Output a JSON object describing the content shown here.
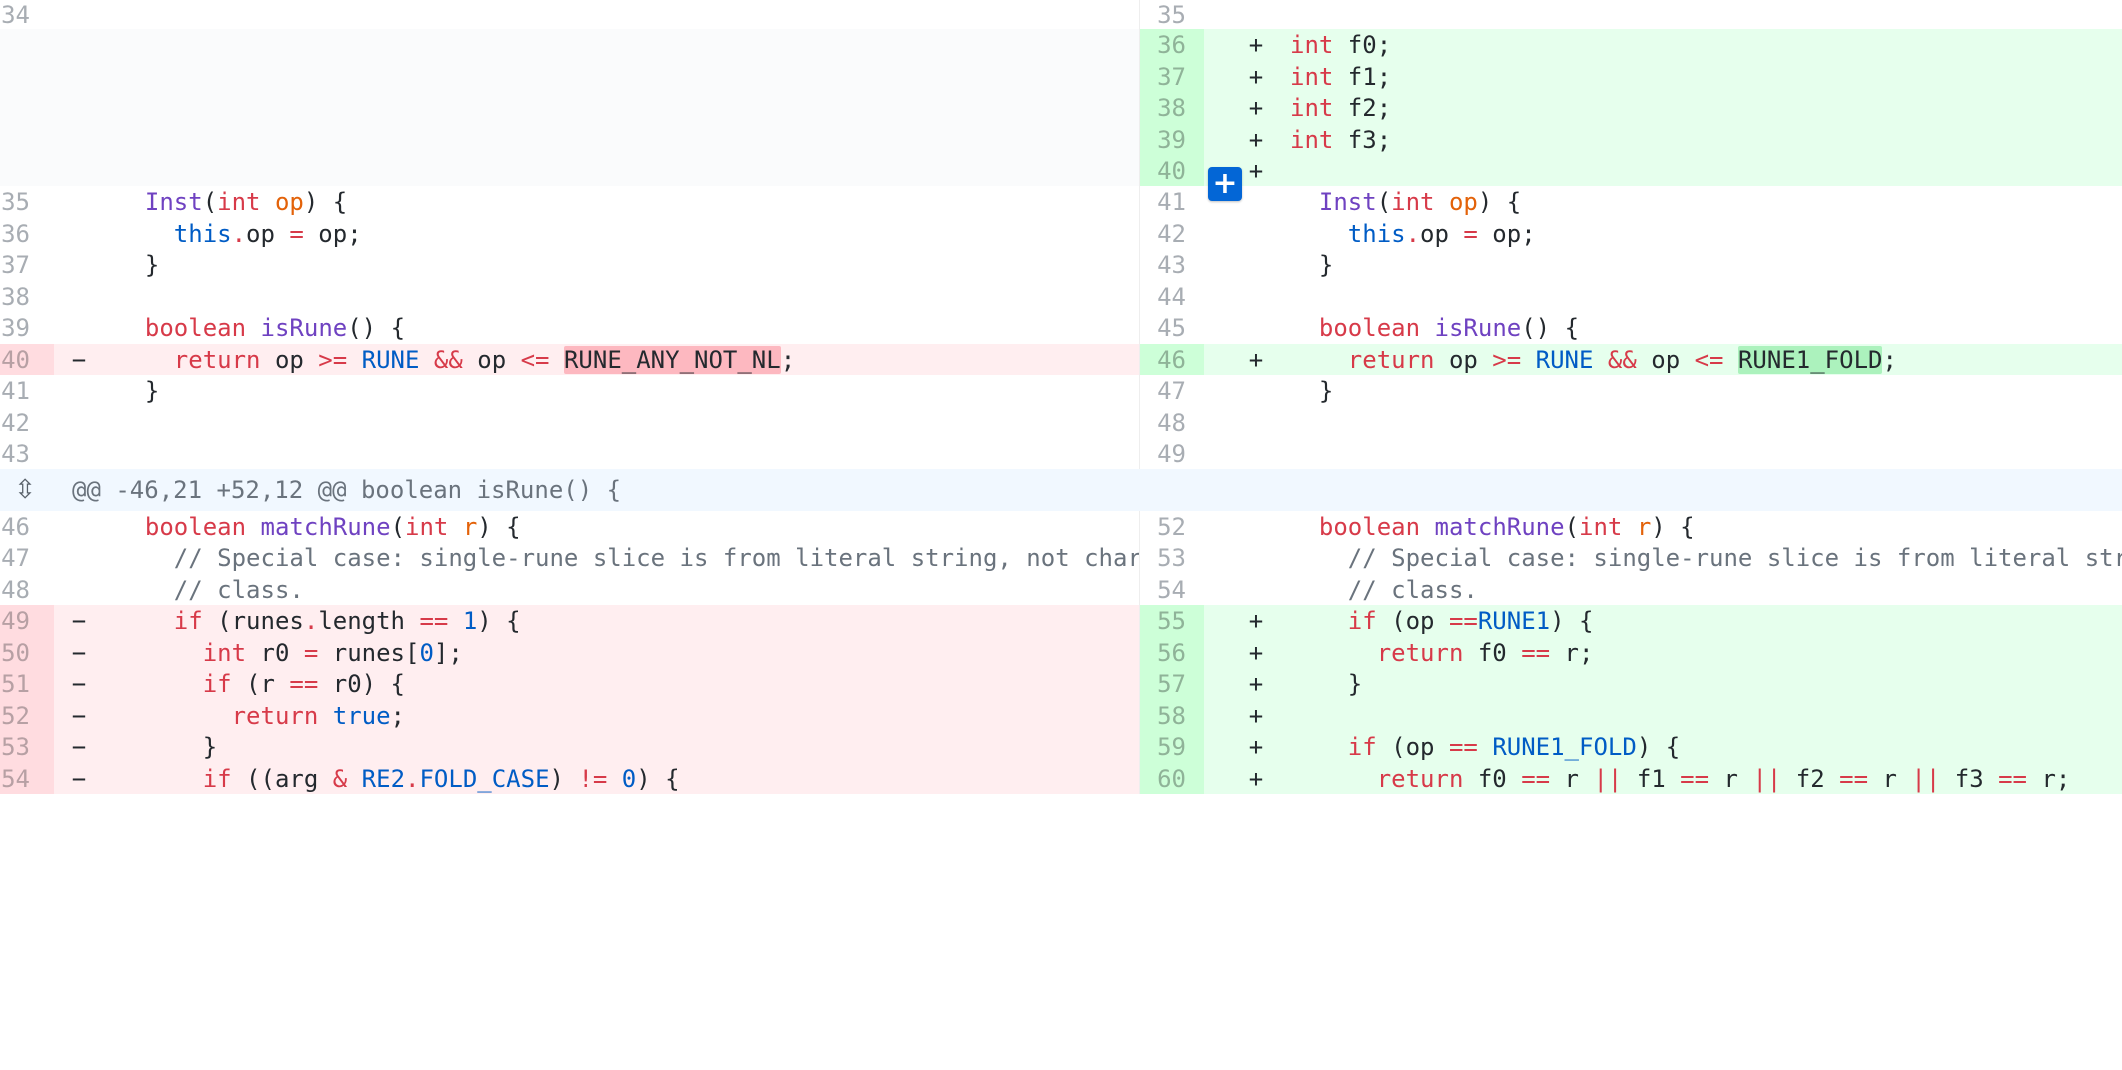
{
  "diff": {
    "colors": {
      "deletion_bg": "#ffeef0",
      "deletion_num_bg": "#ffdce0",
      "deletion_highlight": "#fdb8c0",
      "addition_bg": "#e6ffed",
      "addition_num_bg": "#cdffd8",
      "addition_highlight": "#acf2bd",
      "hunk_bg": "#f1f8ff",
      "empty_bg": "#fafbfc"
    },
    "hunk_header": "@@ -46,21 +52,12 @@ boolean isRune() {",
    "hunk_expand_icon": "unfold-icon",
    "add_comment_icon": "plus-icon",
    "add_comment_label": "+",
    "rows": [
      {
        "left": {
          "num": "34",
          "type": "ctx",
          "sign": "",
          "tokens": []
        },
        "right": {
          "num": "35",
          "type": "ctx",
          "sign": "",
          "tokens": []
        }
      },
      {
        "left": {
          "num": "",
          "type": "empty",
          "sign": "",
          "tokens": []
        },
        "right": {
          "num": "36",
          "type": "add",
          "sign": "+",
          "tokens": [
            {
              "t": "int",
              "c": "type"
            },
            {
              "t": " f0;"
            }
          ]
        }
      },
      {
        "left": {
          "num": "",
          "type": "empty",
          "sign": "",
          "tokens": []
        },
        "right": {
          "num": "37",
          "type": "add",
          "sign": "+",
          "tokens": [
            {
              "t": "int",
              "c": "type"
            },
            {
              "t": " f1;"
            }
          ]
        }
      },
      {
        "left": {
          "num": "",
          "type": "empty",
          "sign": "",
          "tokens": []
        },
        "right": {
          "num": "38",
          "type": "add",
          "sign": "+",
          "tokens": [
            {
              "t": "int",
              "c": "type"
            },
            {
              "t": " f2;"
            }
          ]
        }
      },
      {
        "left": {
          "num": "",
          "type": "empty",
          "sign": "",
          "tokens": []
        },
        "right": {
          "num": "39",
          "type": "add",
          "sign": "+",
          "tokens": [
            {
              "t": "int",
              "c": "type"
            },
            {
              "t": " f3;"
            }
          ]
        }
      },
      {
        "left": {
          "num": "",
          "type": "empty",
          "sign": "",
          "tokens": []
        },
        "right": {
          "num": "40",
          "type": "add",
          "sign": "+",
          "tokens": []
        }
      },
      {
        "left": {
          "num": "35",
          "type": "ctx",
          "sign": "",
          "tokens": [
            {
              "t": "  "
            },
            {
              "t": "Inst",
              "c": "fn"
            },
            {
              "t": "("
            },
            {
              "t": "int",
              "c": "type"
            },
            {
              "t": " "
            },
            {
              "t": "op",
              "c": "param"
            },
            {
              "t": ") {"
            }
          ]
        },
        "right": {
          "num": "41",
          "type": "ctx",
          "sign": "",
          "tokens": [
            {
              "t": "  "
            },
            {
              "t": "Inst",
              "c": "fn"
            },
            {
              "t": "("
            },
            {
              "t": "int",
              "c": "type"
            },
            {
              "t": " "
            },
            {
              "t": "op",
              "c": "param"
            },
            {
              "t": ") {"
            }
          ]
        }
      },
      {
        "left": {
          "num": "36",
          "type": "ctx",
          "sign": "",
          "tokens": [
            {
              "t": "    "
            },
            {
              "t": "this",
              "c": "const"
            },
            {
              "t": ".",
              "c": "op"
            },
            {
              "t": "op "
            },
            {
              "t": "=",
              "c": "op"
            },
            {
              "t": " op;"
            }
          ]
        },
        "right": {
          "num": "42",
          "type": "ctx",
          "sign": "",
          "tokens": [
            {
              "t": "    "
            },
            {
              "t": "this",
              "c": "const"
            },
            {
              "t": ".",
              "c": "op"
            },
            {
              "t": "op "
            },
            {
              "t": "=",
              "c": "op"
            },
            {
              "t": " op;"
            }
          ]
        }
      },
      {
        "left": {
          "num": "37",
          "type": "ctx",
          "sign": "",
          "tokens": [
            {
              "t": "  }"
            }
          ]
        },
        "right": {
          "num": "43",
          "type": "ctx",
          "sign": "",
          "tokens": [
            {
              "t": "  }"
            }
          ]
        }
      },
      {
        "left": {
          "num": "38",
          "type": "ctx",
          "sign": "",
          "tokens": []
        },
        "right": {
          "num": "44",
          "type": "ctx",
          "sign": "",
          "tokens": []
        }
      },
      {
        "left": {
          "num": "39",
          "type": "ctx",
          "sign": "",
          "tokens": [
            {
              "t": "  "
            },
            {
              "t": "boolean",
              "c": "type"
            },
            {
              "t": " "
            },
            {
              "t": "isRune",
              "c": "fn"
            },
            {
              "t": "() {"
            }
          ]
        },
        "right": {
          "num": "45",
          "type": "ctx",
          "sign": "",
          "tokens": [
            {
              "t": "  "
            },
            {
              "t": "boolean",
              "c": "type"
            },
            {
              "t": " "
            },
            {
              "t": "isRune",
              "c": "fn"
            },
            {
              "t": "() {"
            }
          ]
        }
      },
      {
        "left": {
          "num": "40",
          "type": "del",
          "sign": "−",
          "tokens": [
            {
              "t": "    "
            },
            {
              "t": "return",
              "c": "kw"
            },
            {
              "t": " op "
            },
            {
              "t": ">=",
              "c": "op"
            },
            {
              "t": " "
            },
            {
              "t": "RUNE",
              "c": "const"
            },
            {
              "t": " "
            },
            {
              "t": "&&",
              "c": "op"
            },
            {
              "t": " op "
            },
            {
              "t": "<=",
              "c": "op"
            },
            {
              "t": " "
            },
            {
              "t": "RUNE_ANY_NOT_NL",
              "c": "hl"
            },
            {
              "t": ";"
            }
          ]
        },
        "right": {
          "num": "46",
          "type": "add",
          "sign": "+",
          "tokens": [
            {
              "t": "    "
            },
            {
              "t": "return",
              "c": "kw"
            },
            {
              "t": " op "
            },
            {
              "t": ">=",
              "c": "op"
            },
            {
              "t": " "
            },
            {
              "t": "RUNE",
              "c": "const"
            },
            {
              "t": " "
            },
            {
              "t": "&&",
              "c": "op"
            },
            {
              "t": " op "
            },
            {
              "t": "<=",
              "c": "op"
            },
            {
              "t": " "
            },
            {
              "t": "RUNE1_FOLD",
              "c": "hl"
            },
            {
              "t": ";"
            }
          ]
        }
      },
      {
        "left": {
          "num": "41",
          "type": "ctx",
          "sign": "",
          "tokens": [
            {
              "t": "  }"
            }
          ]
        },
        "right": {
          "num": "47",
          "type": "ctx",
          "sign": "",
          "tokens": [
            {
              "t": "  }"
            }
          ]
        }
      },
      {
        "left": {
          "num": "42",
          "type": "ctx",
          "sign": "",
          "tokens": []
        },
        "right": {
          "num": "48",
          "type": "ctx",
          "sign": "",
          "tokens": []
        }
      },
      {
        "left": {
          "num": "43",
          "type": "ctx",
          "sign": "",
          "tokens": []
        },
        "right": {
          "num": "49",
          "type": "ctx",
          "sign": "",
          "tokens": []
        }
      },
      {
        "hunk": true
      },
      {
        "left": {
          "num": "46",
          "type": "ctx",
          "sign": "",
          "tokens": [
            {
              "t": "  "
            },
            {
              "t": "boolean",
              "c": "type"
            },
            {
              "t": " "
            },
            {
              "t": "matchRune",
              "c": "fn"
            },
            {
              "t": "("
            },
            {
              "t": "int",
              "c": "type"
            },
            {
              "t": " "
            },
            {
              "t": "r",
              "c": "param"
            },
            {
              "t": ") {"
            }
          ]
        },
        "right": {
          "num": "52",
          "type": "ctx",
          "sign": "",
          "tokens": [
            {
              "t": "  "
            },
            {
              "t": "boolean",
              "c": "type"
            },
            {
              "t": " "
            },
            {
              "t": "matchRune",
              "c": "fn"
            },
            {
              "t": "("
            },
            {
              "t": "int",
              "c": "type"
            },
            {
              "t": " "
            },
            {
              "t": "r",
              "c": "param"
            },
            {
              "t": ") {"
            }
          ]
        }
      },
      {
        "left": {
          "num": "47",
          "type": "ctx",
          "sign": "",
          "tokens": [
            {
              "t": "    "
            },
            {
              "t": "// Special case: single-rune slice is from literal string, not char",
              "c": "cmt"
            }
          ]
        },
        "right": {
          "num": "53",
          "type": "ctx",
          "sign": "",
          "tokens": [
            {
              "t": "    "
            },
            {
              "t": "// Special case: single-rune slice is from literal string, not char",
              "c": "cmt"
            }
          ]
        }
      },
      {
        "left": {
          "num": "48",
          "type": "ctx",
          "sign": "",
          "tokens": [
            {
              "t": "    "
            },
            {
              "t": "// class.",
              "c": "cmt"
            }
          ]
        },
        "right": {
          "num": "54",
          "type": "ctx",
          "sign": "",
          "tokens": [
            {
              "t": "    "
            },
            {
              "t": "// class.",
              "c": "cmt"
            }
          ]
        }
      },
      {
        "left": {
          "num": "49",
          "type": "del",
          "sign": "−",
          "tokens": [
            {
              "t": "    "
            },
            {
              "t": "if",
              "c": "kw"
            },
            {
              "t": " (runes"
            },
            {
              "t": ".",
              "c": "op"
            },
            {
              "t": "length "
            },
            {
              "t": "==",
              "c": "op"
            },
            {
              "t": " "
            },
            {
              "t": "1",
              "c": "const"
            },
            {
              "t": ") {"
            }
          ]
        },
        "right": {
          "num": "55",
          "type": "add",
          "sign": "+",
          "tokens": [
            {
              "t": "    "
            },
            {
              "t": "if",
              "c": "kw"
            },
            {
              "t": " (op "
            },
            {
              "t": "==",
              "c": "op"
            },
            {
              "t": "RUNE1",
              "c": "const"
            },
            {
              "t": ") {"
            }
          ]
        }
      },
      {
        "left": {
          "num": "50",
          "type": "del",
          "sign": "−",
          "tokens": [
            {
              "t": "      "
            },
            {
              "t": "int",
              "c": "type"
            },
            {
              "t": " r0 "
            },
            {
              "t": "=",
              "c": "op"
            },
            {
              "t": " runes["
            },
            {
              "t": "0",
              "c": "const"
            },
            {
              "t": "];"
            }
          ]
        },
        "right": {
          "num": "56",
          "type": "add",
          "sign": "+",
          "tokens": [
            {
              "t": "      "
            },
            {
              "t": "return",
              "c": "kw"
            },
            {
              "t": " f0 "
            },
            {
              "t": "==",
              "c": "op"
            },
            {
              "t": " r;"
            }
          ]
        }
      },
      {
        "left": {
          "num": "51",
          "type": "del",
          "sign": "−",
          "tokens": [
            {
              "t": "      "
            },
            {
              "t": "if",
              "c": "kw"
            },
            {
              "t": " (r "
            },
            {
              "t": "==",
              "c": "op"
            },
            {
              "t": " r0) {"
            }
          ]
        },
        "right": {
          "num": "57",
          "type": "add",
          "sign": "+",
          "tokens": [
            {
              "t": "    }"
            }
          ]
        }
      },
      {
        "left": {
          "num": "52",
          "type": "del",
          "sign": "−",
          "tokens": [
            {
              "t": "        "
            },
            {
              "t": "return",
              "c": "kw"
            },
            {
              "t": " "
            },
            {
              "t": "true",
              "c": "const"
            },
            {
              "t": ";"
            }
          ]
        },
        "right": {
          "num": "58",
          "type": "add",
          "sign": "+",
          "tokens": []
        }
      },
      {
        "left": {
          "num": "53",
          "type": "del",
          "sign": "−",
          "tokens": [
            {
              "t": "      }"
            }
          ]
        },
        "right": {
          "num": "59",
          "type": "add",
          "sign": "+",
          "tokens": [
            {
              "t": "    "
            },
            {
              "t": "if",
              "c": "kw"
            },
            {
              "t": " (op "
            },
            {
              "t": "==",
              "c": "op"
            },
            {
              "t": " "
            },
            {
              "t": "RUNE1_FOLD",
              "c": "const"
            },
            {
              "t": ") {"
            }
          ]
        }
      },
      {
        "left": {
          "num": "54",
          "type": "del",
          "sign": "−",
          "tokens": [
            {
              "t": "      "
            },
            {
              "t": "if",
              "c": "kw"
            },
            {
              "t": " ((arg "
            },
            {
              "t": "&",
              "c": "op"
            },
            {
              "t": " "
            },
            {
              "t": "RE2",
              "c": "const"
            },
            {
              "t": ".",
              "c": "op"
            },
            {
              "t": "FOLD_CASE",
              "c": "const"
            },
            {
              "t": ") "
            },
            {
              "t": "!=",
              "c": "op"
            },
            {
              "t": " "
            },
            {
              "t": "0",
              "c": "const"
            },
            {
              "t": ") {"
            }
          ]
        },
        "right": {
          "num": "60",
          "type": "add",
          "sign": "+",
          "tokens": [
            {
              "t": "      "
            },
            {
              "t": "return",
              "c": "kw"
            },
            {
              "t": " f0 "
            },
            {
              "t": "==",
              "c": "op"
            },
            {
              "t": " r "
            },
            {
              "t": "||",
              "c": "op"
            },
            {
              "t": " f1 "
            },
            {
              "t": "==",
              "c": "op"
            },
            {
              "t": " r "
            },
            {
              "t": "||",
              "c": "op"
            },
            {
              "t": " f2 "
            },
            {
              "t": "==",
              "c": "op"
            },
            {
              "t": " r "
            },
            {
              "t": "||",
              "c": "op"
            },
            {
              "t": " f3 "
            },
            {
              "t": "==",
              "c": "op"
            },
            {
              "t": " r;"
            }
          ]
        }
      }
    ]
  }
}
